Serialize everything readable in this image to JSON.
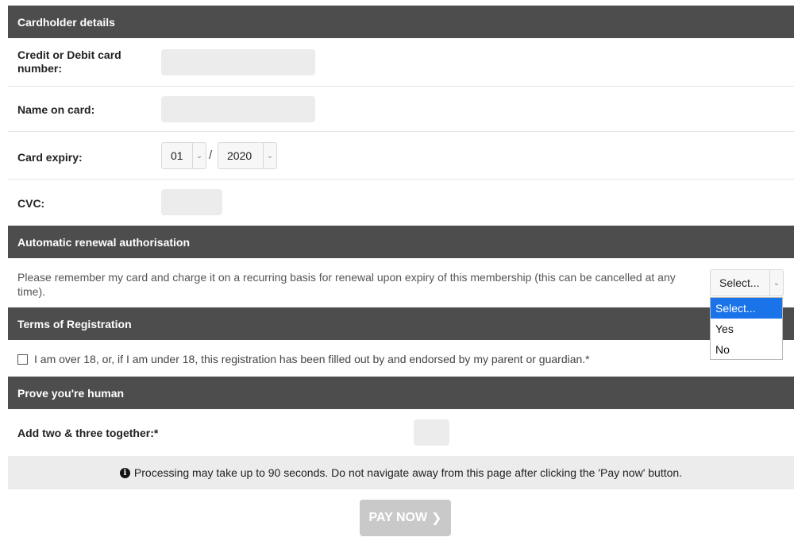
{
  "sections": {
    "cardholder": "Cardholder details",
    "renewal": "Automatic renewal authorisation",
    "terms": "Terms of Registration",
    "human": "Prove you're human"
  },
  "card": {
    "number_label": "Credit or Debit card number:",
    "name_label": "Name on card:",
    "expiry_label": "Card expiry:",
    "expiry_month": "01",
    "expiry_separator": "/",
    "expiry_year": "2020",
    "cvc_label": "CVC:"
  },
  "renewal": {
    "text": "Please remember my card and charge it on a recurring basis for renewal upon expiry of this membership (this can be cancelled at any time).",
    "select_value": "Select...",
    "options": [
      "Select...",
      "Yes",
      "No"
    ]
  },
  "terms": {
    "checkbox_text": "I am over 18, or, if I am under 18, this registration has been filled out by and endorsed by my parent or guardian.*"
  },
  "human": {
    "question": "Add two & three together:*"
  },
  "notice": {
    "text": "Processing may take up to 90 seconds. Do not navigate away from this page after clicking the 'Pay now' button."
  },
  "pay_button": {
    "label": "PAY NOW"
  },
  "colors": {
    "header_bg": "#4d4d4d",
    "input_bg": "#ececec",
    "selected_option": "#1a73e8",
    "button_disabled": "#c9c9c9"
  }
}
